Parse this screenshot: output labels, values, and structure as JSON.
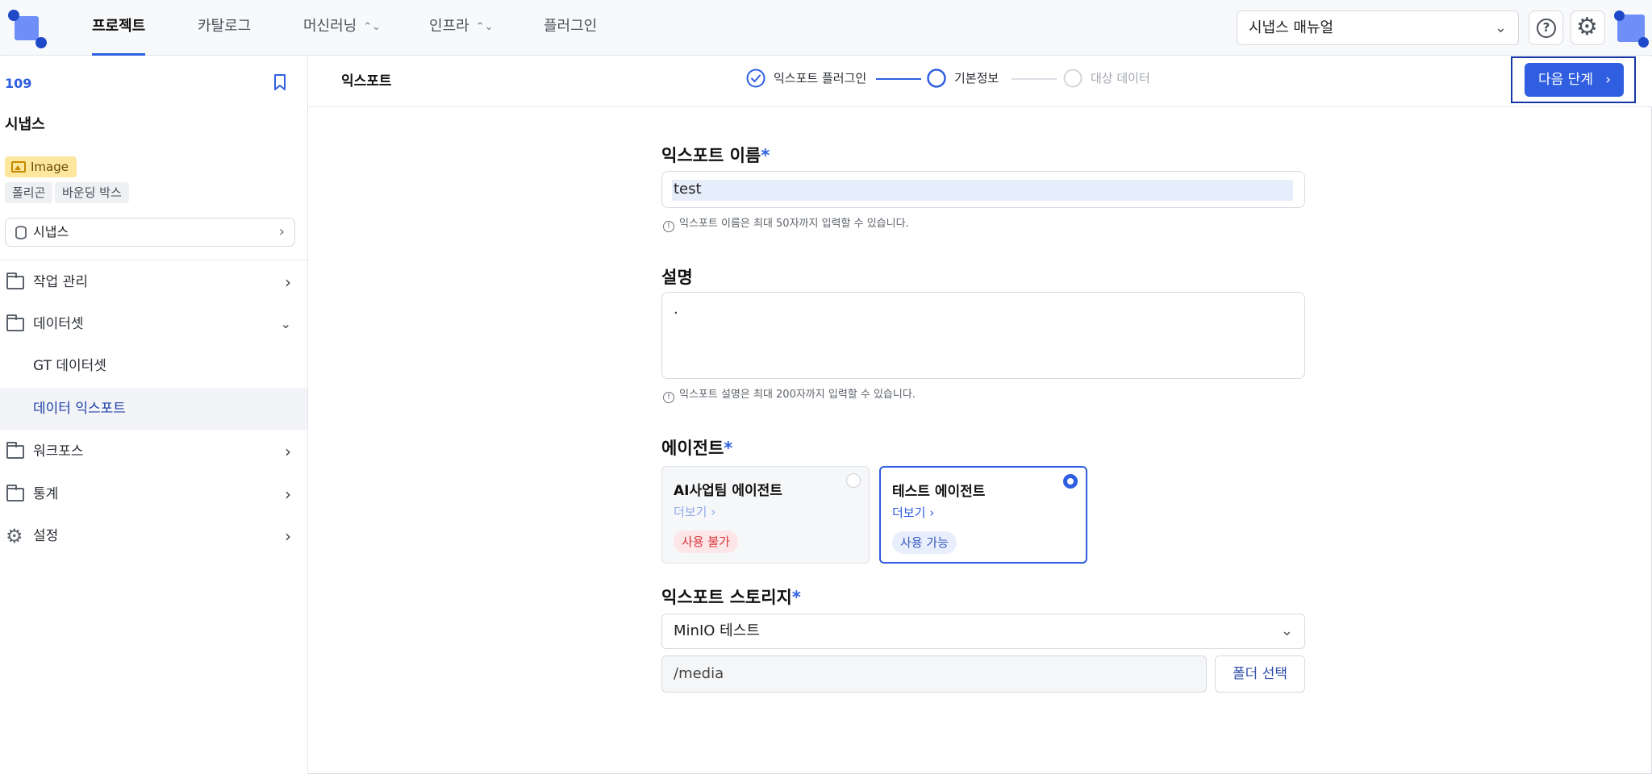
{
  "topnav": {
    "tabs": [
      {
        "label": "프로젝트",
        "active": true
      },
      {
        "label": "카탈로그"
      },
      {
        "label": "머신러닝"
      },
      {
        "label": "인프라"
      },
      {
        "label": "플러그인"
      }
    ],
    "manual_select": "시냅스 매뉴얼"
  },
  "sidebar": {
    "project_id": "109",
    "project_name": "시냅스",
    "data_type": "Image",
    "tags": [
      "폴리곤",
      "바운딩 박스"
    ],
    "dataset": "시냅스",
    "menu": {
      "task": "작업 관리",
      "dataset": "데이터셋",
      "gt_dataset": "GT 데이터셋",
      "data_export": "데이터 익스포트",
      "workforce": "워크포스",
      "stats": "통계",
      "settings": "설정"
    }
  },
  "header": {
    "title": "익스포트",
    "steps": [
      "익스포트 플러그인",
      "기본정보",
      "대상 데이터"
    ],
    "next_button": "다음 단계"
  },
  "form": {
    "name_label": "익스포트 이름",
    "name_value": "test",
    "name_hint": "익스포트 이름은 최대 50자까지 입력할 수 있습니다.",
    "desc_label": "설명",
    "desc_value": ".",
    "desc_hint": "익스포트 설명은 최대 200자까지 입력할 수 있습니다.",
    "agent_label": "에이전트",
    "agents": [
      {
        "name": "AI사업팀 에이전트",
        "more": "더보기",
        "status": "사용 불가"
      },
      {
        "name": "테스트 에이전트",
        "more": "더보기",
        "status": "사용 가능"
      }
    ],
    "storage_label": "익스포트 스토리지",
    "storage_value": "MinIO 테스트",
    "path_value": "/media",
    "folder_button": "폴더 선택",
    "required_mark": "*"
  },
  "colors": {
    "accent": "#2f5fe0",
    "unavailable": "#d9363e",
    "available": "#3a5bbf"
  }
}
